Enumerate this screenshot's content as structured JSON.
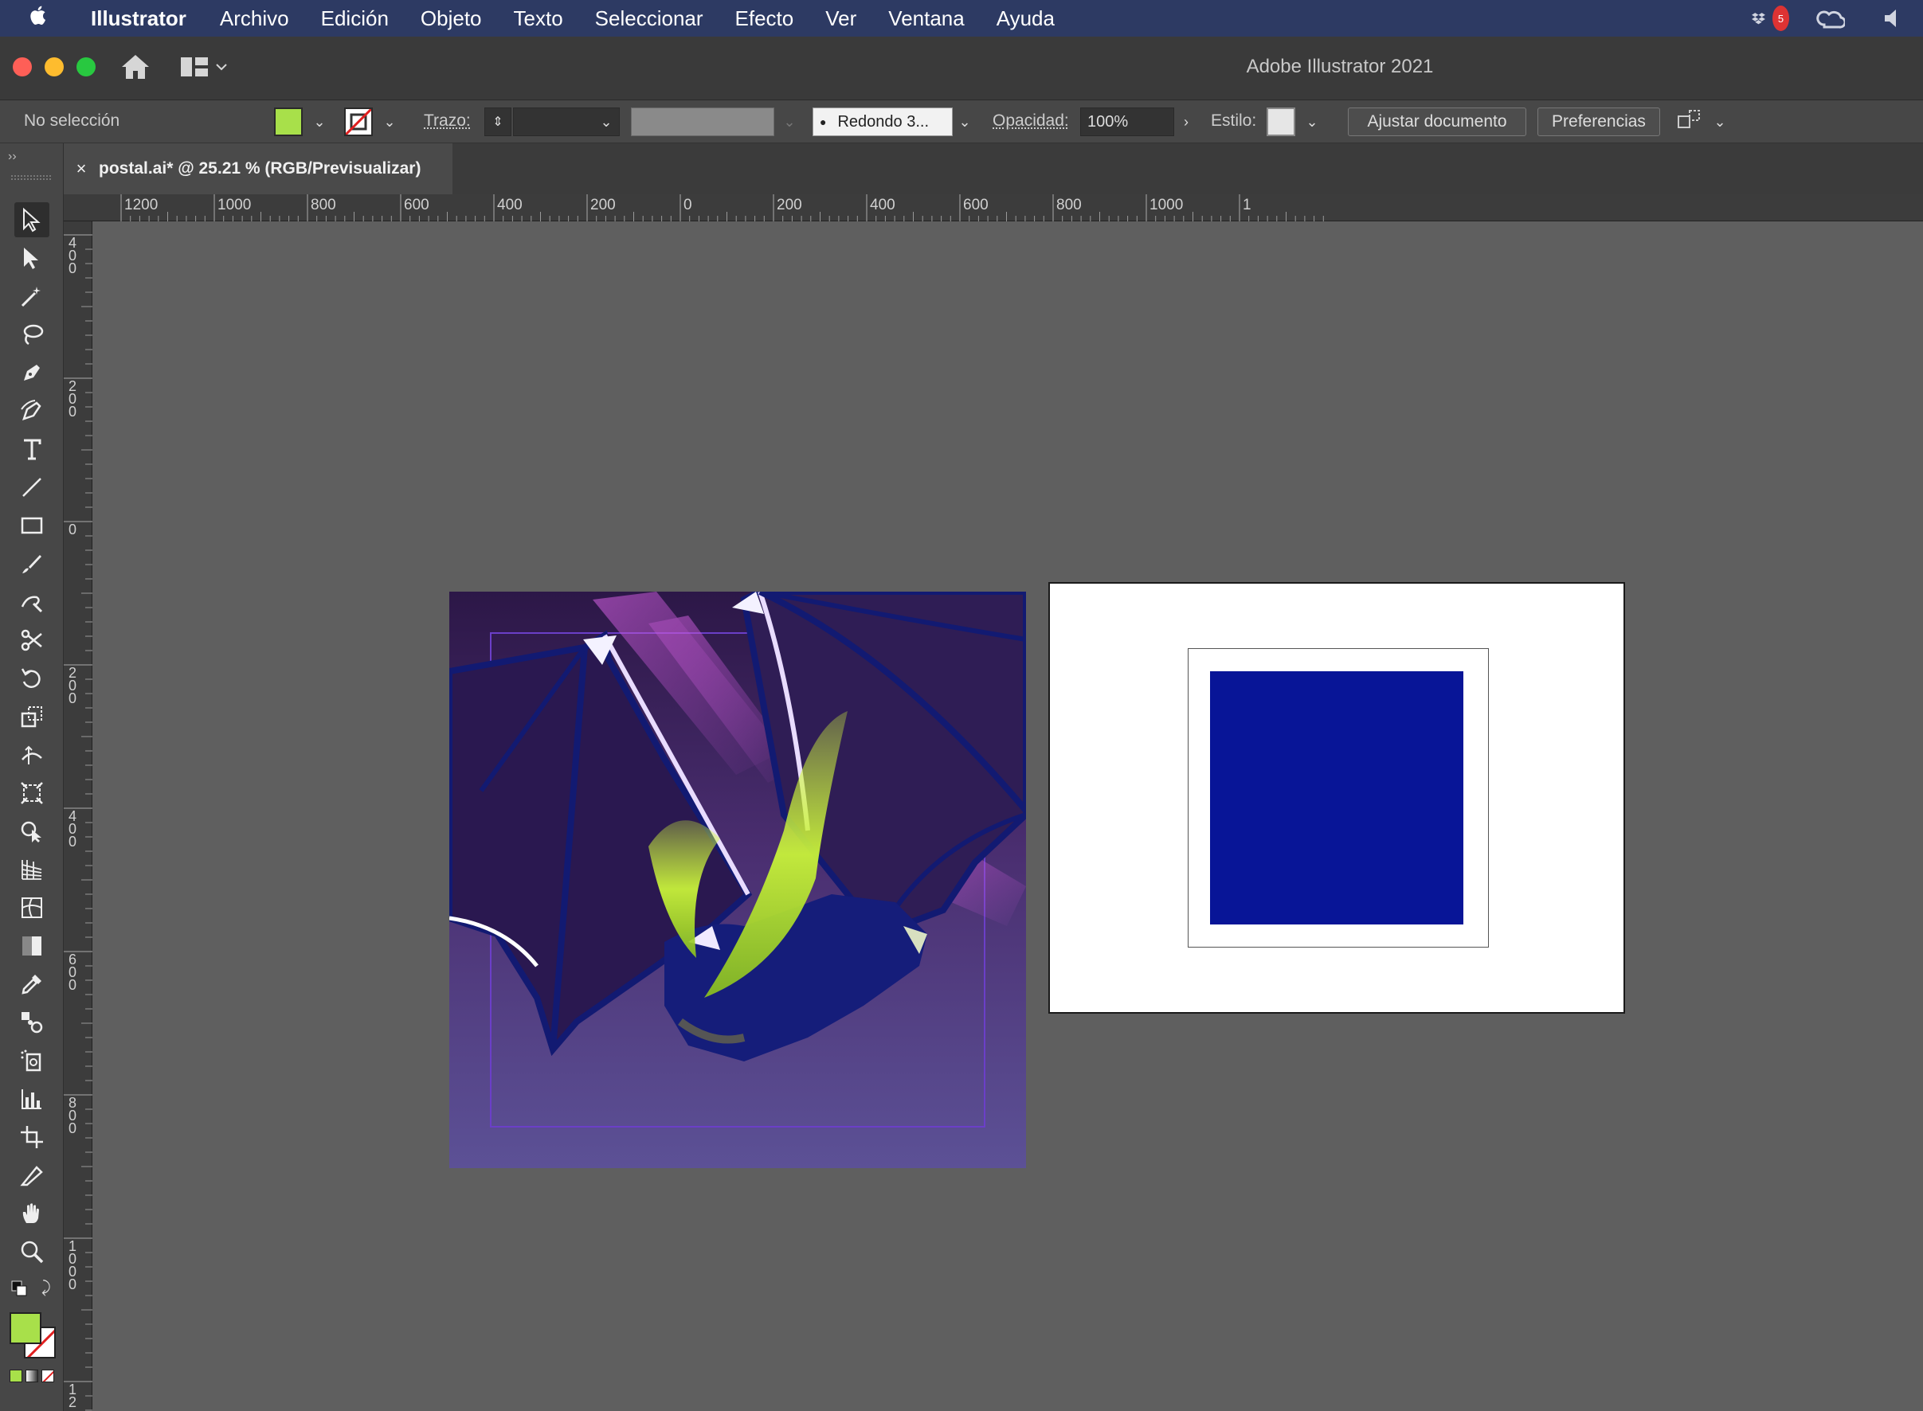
{
  "menubar": {
    "app_name": "Illustrator",
    "items": [
      "Archivo",
      "Edición",
      "Objeto",
      "Texto",
      "Seleccionar",
      "Efecto",
      "Ver",
      "Ventana",
      "Ayuda"
    ],
    "dropbox_badge": "5"
  },
  "window": {
    "title": "Adobe Illustrator 2021"
  },
  "control_bar": {
    "selection_status": "No selección",
    "fill_color": "#a8e04a",
    "stroke_label": "Trazo:",
    "stroke_weight": "",
    "brush_label": "Redondo 3...",
    "opacity_label": "Opacidad:",
    "opacity_value": "100%",
    "style_label": "Estilo:",
    "fit_document_button": "Ajustar documento",
    "preferences_button": "Preferencias"
  },
  "document_tab": {
    "close": "×",
    "title": "postal.ai* @ 25.21 % (RGB/Previsualizar)"
  },
  "rulers": {
    "horizontal_ticks": [
      "1200",
      "1000",
      "800",
      "600",
      "400",
      "200",
      "0",
      "200",
      "400",
      "600",
      "800",
      "1000",
      "1"
    ],
    "vertical_ticks": [
      "400",
      "200",
      "0",
      "200",
      "400",
      "600",
      "800",
      "1000",
      "12"
    ]
  },
  "tools": [
    "selection-tool",
    "direct-selection-tool",
    "magic-wand-tool",
    "lasso-tool",
    "pen-tool",
    "curvature-tool",
    "type-tool",
    "line-segment-tool",
    "rectangle-tool",
    "paintbrush-tool",
    "shaper-tool",
    "scissors-tool",
    "rotate-tool",
    "scale-tool",
    "width-tool",
    "free-transform-tool",
    "shape-builder-tool",
    "perspective-grid-tool",
    "mesh-tool",
    "gradient-tool",
    "eyedropper-tool",
    "blend-tool",
    "symbol-sprayer-tool",
    "column-graph-tool",
    "artboard-tool",
    "slice-tool",
    "hand-tool",
    "zoom-tool"
  ],
  "colors": {
    "menubar_bg": "#2d3a63",
    "fill_swatch": "#a8e04a",
    "artboard_square": "#081597",
    "artwork_top": "#3a1f5a",
    "artwork_bottom": "#5b4f96"
  }
}
